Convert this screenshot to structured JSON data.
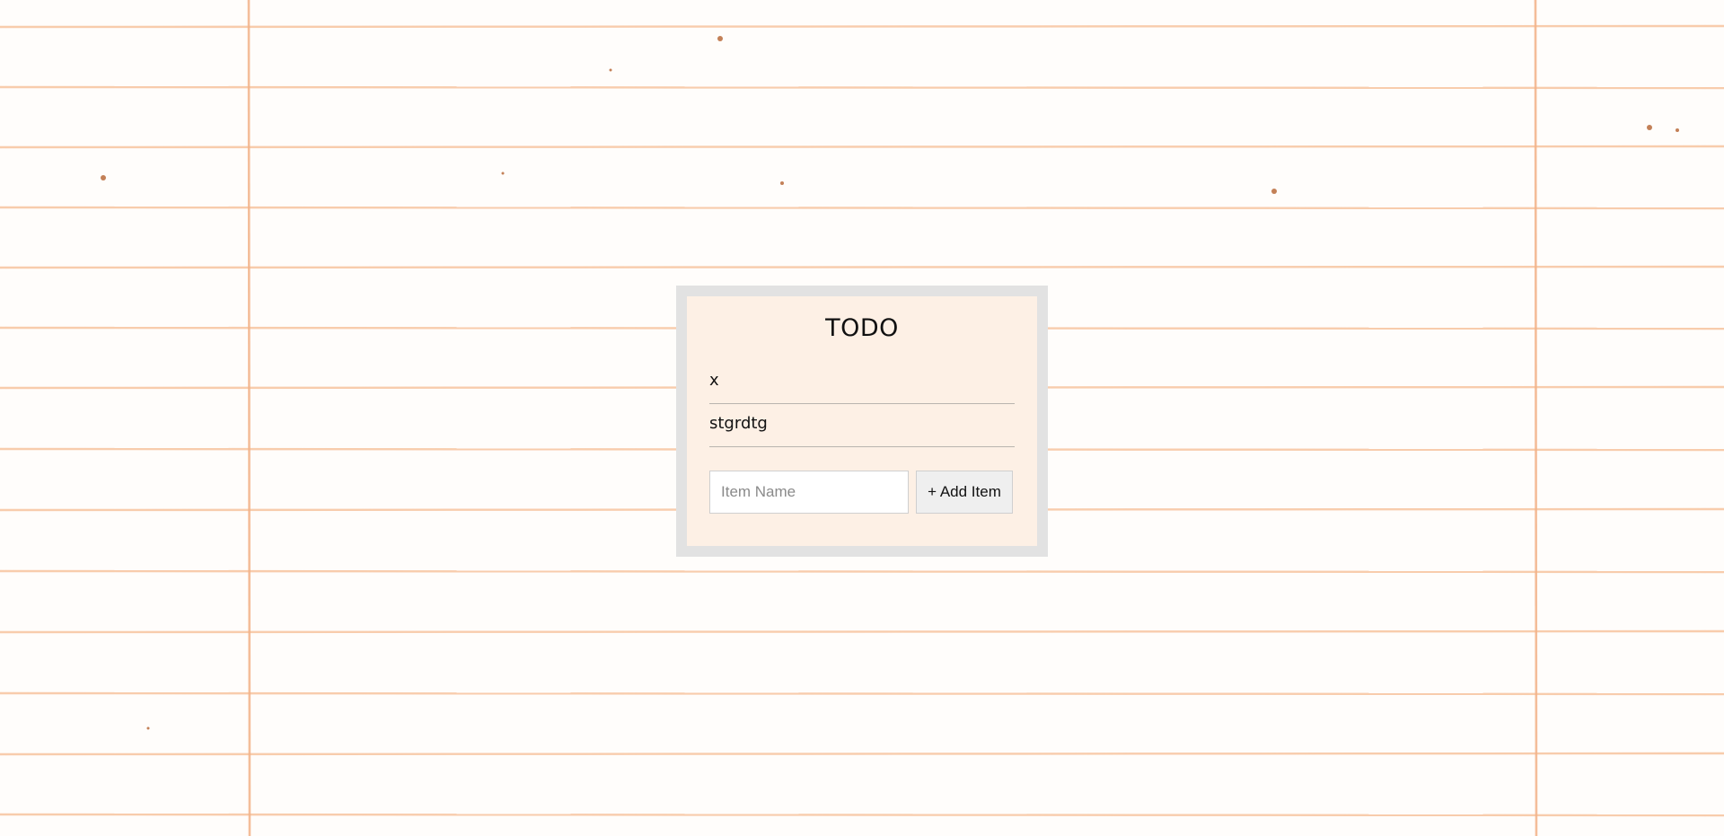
{
  "app": {
    "title": "TODO"
  },
  "todos": [
    {
      "label": "x"
    },
    {
      "label": "stgrdtg"
    }
  ],
  "add_form": {
    "placeholder": "Item Name",
    "value": "",
    "button_label": "+ Add Item"
  },
  "colors": {
    "background_paper": "#fffdfb",
    "ruled_line": "#f6b98e",
    "margin_line": "#f2b187",
    "card_frame": "#e2e2e2",
    "card_bg": "#fdf0e5"
  }
}
